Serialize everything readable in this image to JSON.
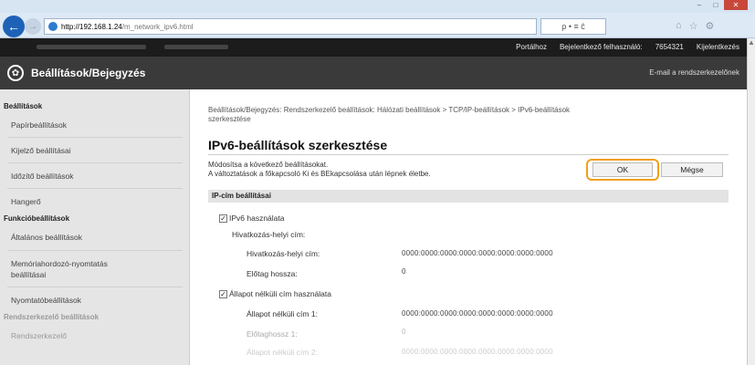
{
  "browser": {
    "url_host": "http://192.168.1.24",
    "url_path": "/m_network_ipv6.html",
    "addr_icons": "ρ • ≡ ĉ",
    "win_controls": [
      "–",
      "□",
      "✕"
    ],
    "tool_icons": [
      "⌂",
      "☆",
      "⚙"
    ]
  },
  "topbar": {
    "portal": "Portálhoz",
    "user_label": "Bejelentkező felhasználó:",
    "user_id": "7654321",
    "logout": "Kijelentkezés"
  },
  "header": {
    "title": "Beállítások/Bejegyzés",
    "email": "E-mail a rendszerkezelőnek"
  },
  "sidebar": {
    "section1": "Beállítások",
    "items1": [
      "Papírbeállítások",
      "Kijelző beállításai",
      "Időzítő beállítások",
      "Hangerő"
    ],
    "section2": "Funkcióbeállítások",
    "items2": [
      "Általános beállítások",
      "Memóriahordozó-nyomtatás",
      "beállításai",
      "Nyomtatóbeállítások"
    ],
    "section3": "Rendszerkezelő beállítások",
    "item3": "Rendszerkezelő"
  },
  "main": {
    "breadcrumb_line1": "Beállítások/Bejegyzés: Rendszerkezelő beállítások: Hálózati beállítások > TCP/IP-beállítások > IPv6-beállítások",
    "breadcrumb_line2": "szerkesztése",
    "title": "IPv6-beállítások szerkesztése",
    "desc1": "Módosítsa a következő beállításokat.",
    "desc2": "A változtatások a főkapcsoló Ki és BEkapcsolása után lépnek életbe.",
    "ok": "OK",
    "cancel": "Mégse",
    "section": "IP-cím beállításai",
    "use_ipv6": "IPv6 használata",
    "link_local_heading": "Hivatkozás-helyi cím:",
    "link_local_label": "Hivatkozás-helyi cím:",
    "link_local_value": "0000:0000:0000:0000:0000:0000:0000:0000",
    "prefix_label": "Előtag hossza:",
    "prefix_value": "0",
    "stateless_use": "Állapot nélküli cím használata",
    "stateless1_label": "Állapot nélküli cím 1:",
    "stateless1_value": "0000:0000:0000:0000:0000:0000:0000:0000",
    "prefix1_label": "Előtaghossz 1:",
    "prefix1_value": "0",
    "stateless2_label": "Állapot nélküli cím 2:",
    "stateless2_value": "0000:0000:0000:0000:0000:0000:0000:0000"
  }
}
